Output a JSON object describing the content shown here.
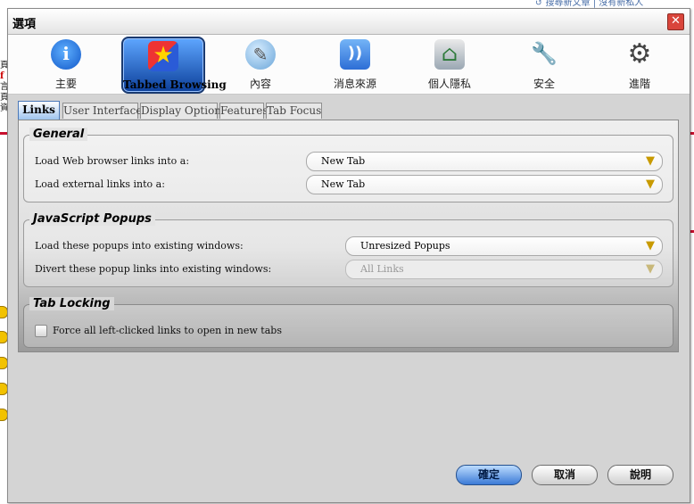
{
  "background": {
    "top_strip": "↺ 搜尋新文章 | 沒有新私人",
    "left_chars": [
      "頁",
      "f",
      "言",
      "頁",
      "資"
    ]
  },
  "dialog": {
    "title": "選項",
    "close_label": "✕"
  },
  "toolbar": {
    "items": [
      {
        "label": "主要",
        "icon": "info-icon"
      },
      {
        "label": "Tabbed Browsing",
        "icon": "tabbed-browsing-icon",
        "selected": true
      },
      {
        "label": "內容",
        "icon": "content-icon"
      },
      {
        "label": "消息來源",
        "icon": "rss-feed-icon"
      },
      {
        "label": "個人隱私",
        "icon": "privacy-icon"
      },
      {
        "label": "安全",
        "icon": "security-icon"
      },
      {
        "label": "進階",
        "icon": "advanced-gear-icon"
      }
    ]
  },
  "subtabs": [
    "Links",
    "User Interface",
    "Display Options",
    "Features",
    "Tab Focus"
  ],
  "active_subtab": "Links",
  "general": {
    "legend": "General",
    "rows": [
      {
        "label": "Load Web browser links into a:",
        "value": "New Tab"
      },
      {
        "label": "Load external links into a:",
        "value": "New Tab"
      }
    ]
  },
  "popups": {
    "legend": "JavaScript Popups",
    "rows": [
      {
        "label": "Load these popups into existing windows:",
        "value": "Unresized Popups",
        "disabled": false
      },
      {
        "label": "Divert these popup links into existing windows:",
        "value": "All Links",
        "disabled": true
      }
    ]
  },
  "locking": {
    "legend": "Tab Locking",
    "checkbox_label": "Force all left-clicked links to open in new tabs",
    "checked": false
  },
  "buttons": {
    "ok": "確定",
    "cancel": "取消",
    "help": "說明"
  },
  "colors": {
    "accent": "#2d6ed6",
    "title_close": "#d9453b"
  }
}
